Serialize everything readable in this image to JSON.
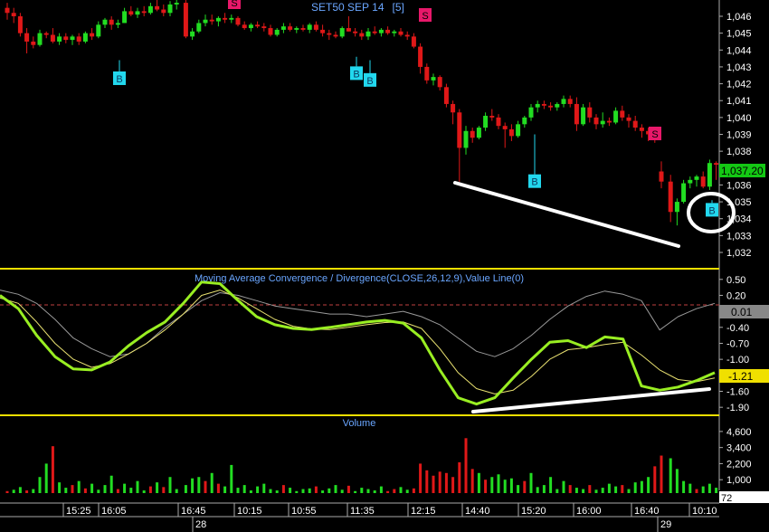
{
  "colors": {
    "background": "#000000",
    "up_candle": "#22dd22",
    "down_candle": "#e01818",
    "panel_border": "#f0e000",
    "title_text": "#6aa6ff",
    "axis_text": "#ffffff",
    "buy_marker": "#22d8ee",
    "sell_marker": "#e8186a",
    "macd_line": "#99ee22",
    "signal_line": "#e8e070",
    "value_line": "#999999",
    "zero_line": "#c04040",
    "price_tag_bg": "#14c814",
    "macd_tag_bg": "#f0e000",
    "volume_tag_bg": "#ffffff",
    "trendline": "#ffffff"
  },
  "price_panel": {
    "title": "SET50 SEP 14",
    "interval": "[5]",
    "last_price_tag": "1,037.20",
    "y_ticks": [
      "1,046",
      "1,045",
      "1,044",
      "1,043",
      "1,042",
      "1,041",
      "1,040",
      "1,039",
      "1,038",
      "1,037",
      "1,036",
      "1,035",
      "1,034",
      "1,033",
      "1,032"
    ]
  },
  "macd_panel": {
    "title": "Moving Average Convergence / Divergence(CLOSE,26,12,9),Value Line(0)",
    "y_ticks": [
      "0.50",
      "0.20",
      "-0.10",
      "-0.40",
      "-0.70",
      "-1.00",
      "-1.30",
      "-1.60",
      "-1.90"
    ],
    "value_tags": [
      "0.01",
      "-1.21"
    ]
  },
  "volume_panel": {
    "title": "Volume",
    "y_ticks": [
      "4,600",
      "3,400",
      "2,200",
      "1,000"
    ],
    "value_tag": "72"
  },
  "x_axis": {
    "time_labels": [
      "15:25",
      "16:05",
      "16:45",
      "10:15",
      "10:55",
      "11:35",
      "12:15",
      "14:40",
      "15:20",
      "16:00",
      "16:40",
      "10:10"
    ],
    "date_labels": [
      "28",
      "29"
    ]
  },
  "signal_label_buy": "B",
  "signal_label_sell": "S",
  "chart_data": {
    "type": "candlestick",
    "title": "SET50 SEP 14 [5]",
    "ylim": [
      1031.5,
      1047
    ],
    "candles": [
      [
        1046.5,
        1046.8,
        1045.8,
        1046.2
      ],
      [
        1046.2,
        1046.5,
        1045.6,
        1046.0
      ],
      [
        1046.0,
        1046.2,
        1044.8,
        1045.0
      ],
      [
        1045.0,
        1045.3,
        1043.8,
        1044.5
      ],
      [
        1044.5,
        1044.8,
        1044.1,
        1044.3
      ],
      [
        1044.3,
        1045.2,
        1044.2,
        1045.0
      ],
      [
        1045.0,
        1045.1,
        1044.7,
        1044.9
      ],
      [
        1044.9,
        1045.3,
        1044.4,
        1044.5
      ],
      [
        1044.5,
        1045.0,
        1044.3,
        1044.8
      ],
      [
        1044.8,
        1045.0,
        1044.4,
        1044.6
      ],
      [
        1044.6,
        1044.9,
        1044.3,
        1044.8
      ],
      [
        1044.8,
        1045.0,
        1044.3,
        1044.5
      ],
      [
        1044.5,
        1045.1,
        1044.4,
        1045.0
      ],
      [
        1045.0,
        1045.3,
        1044.6,
        1044.8
      ],
      [
        1044.8,
        1045.7,
        1044.7,
        1045.5
      ],
      [
        1045.5,
        1045.9,
        1045.3,
        1045.8
      ],
      [
        1045.8,
        1046.0,
        1045.2,
        1045.5
      ],
      [
        1045.5,
        1045.8,
        1045.3,
        1045.6
      ],
      [
        1045.6,
        1046.5,
        1045.6,
        1046.3
      ],
      [
        1046.3,
        1046.6,
        1046.0,
        1046.1
      ],
      [
        1046.1,
        1046.5,
        1045.9,
        1046.3
      ],
      [
        1046.3,
        1046.6,
        1046.0,
        1046.2
      ],
      [
        1046.2,
        1046.8,
        1046.1,
        1046.6
      ],
      [
        1046.6,
        1047.0,
        1046.3,
        1046.4
      ],
      [
        1046.4,
        1046.7,
        1046.0,
        1046.2
      ],
      [
        1046.2,
        1046.9,
        1046.0,
        1046.7
      ],
      [
        1046.7,
        1047.0,
        1046.4,
        1046.8
      ],
      [
        1046.8,
        1047.0,
        1044.7,
        1044.8
      ],
      [
        1044.8,
        1045.3,
        1044.6,
        1045.1
      ],
      [
        1045.1,
        1045.8,
        1045.0,
        1045.6
      ],
      [
        1045.6,
        1046.1,
        1045.4,
        1045.8
      ],
      [
        1045.8,
        1046.1,
        1045.5,
        1045.7
      ],
      [
        1045.7,
        1046.0,
        1045.4,
        1045.9
      ],
      [
        1045.9,
        1046.2,
        1045.6,
        1045.8
      ],
      [
        1045.8,
        1046.1,
        1045.6,
        1045.9
      ],
      [
        1045.9,
        1046.0,
        1045.4,
        1045.5
      ],
      [
        1045.5,
        1045.7,
        1045.2,
        1045.3
      ],
      [
        1045.3,
        1045.6,
        1045.1,
        1045.5
      ],
      [
        1045.5,
        1045.7,
        1045.3,
        1045.4
      ],
      [
        1045.4,
        1045.6,
        1045.1,
        1045.3
      ],
      [
        1045.3,
        1045.5,
        1044.8,
        1044.9
      ],
      [
        1044.9,
        1045.3,
        1044.8,
        1045.2
      ],
      [
        1045.2,
        1045.6,
        1045.0,
        1045.4
      ],
      [
        1045.4,
        1045.6,
        1045.1,
        1045.2
      ],
      [
        1045.2,
        1045.4,
        1045.0,
        1045.3
      ],
      [
        1045.3,
        1045.5,
        1045.1,
        1045.2
      ],
      [
        1045.2,
        1045.6,
        1045.0,
        1045.5
      ],
      [
        1045.5,
        1045.7,
        1045.1,
        1045.2
      ],
      [
        1045.2,
        1045.5,
        1044.8,
        1045.0
      ],
      [
        1045.0,
        1045.2,
        1044.6,
        1044.9
      ],
      [
        1044.9,
        1045.1,
        1044.7,
        1044.8
      ],
      [
        1044.8,
        1045.4,
        1044.7,
        1045.3
      ],
      [
        1045.3,
        1046.0,
        1045.1,
        1045.1
      ],
      [
        1045.1,
        1045.3,
        1044.8,
        1045.0
      ],
      [
        1045.0,
        1045.2,
        1044.6,
        1044.8
      ],
      [
        1044.8,
        1045.3,
        1044.6,
        1045.1
      ],
      [
        1045.1,
        1045.4,
        1044.9,
        1045.0
      ],
      [
        1045.0,
        1045.3,
        1044.8,
        1045.2
      ],
      [
        1045.2,
        1045.4,
        1044.9,
        1045.0
      ],
      [
        1045.0,
        1045.2,
        1044.8,
        1045.1
      ],
      [
        1045.1,
        1045.3,
        1044.8,
        1044.9
      ],
      [
        1044.9,
        1045.1,
        1044.6,
        1044.8
      ],
      [
        1044.8,
        1045.0,
        1044.1,
        1044.2
      ],
      [
        1044.2,
        1044.4,
        1042.6,
        1043.0
      ],
      [
        1043.0,
        1043.2,
        1042.0,
        1042.2
      ],
      [
        1042.2,
        1042.6,
        1041.9,
        1042.4
      ],
      [
        1042.4,
        1042.5,
        1041.6,
        1041.8
      ],
      [
        1041.8,
        1042.0,
        1040.6,
        1040.8
      ],
      [
        1040.8,
        1041.0,
        1039.6,
        1040.3
      ],
      [
        1040.3,
        1040.5,
        1036.2,
        1038.2
      ],
      [
        1038.2,
        1039.5,
        1037.8,
        1039.2
      ],
      [
        1039.2,
        1039.4,
        1038.5,
        1038.8
      ],
      [
        1038.8,
        1039.5,
        1038.7,
        1039.4
      ],
      [
        1039.4,
        1040.3,
        1039.2,
        1040.1
      ],
      [
        1040.1,
        1040.5,
        1039.8,
        1040.0
      ],
      [
        1040.0,
        1040.2,
        1039.3,
        1039.5
      ],
      [
        1039.5,
        1039.7,
        1038.2,
        1039.3
      ],
      [
        1039.3,
        1039.6,
        1038.6,
        1038.9
      ],
      [
        1038.9,
        1039.8,
        1038.8,
        1039.6
      ],
      [
        1039.6,
        1040.1,
        1039.4,
        1040.0
      ],
      [
        1040.0,
        1040.8,
        1039.8,
        1040.6
      ],
      [
        1040.6,
        1041.0,
        1040.3,
        1040.8
      ],
      [
        1040.8,
        1041.0,
        1040.5,
        1040.7
      ],
      [
        1040.7,
        1040.9,
        1040.4,
        1040.6
      ],
      [
        1040.6,
        1040.9,
        1040.4,
        1040.8
      ],
      [
        1040.8,
        1041.3,
        1040.6,
        1041.1
      ],
      [
        1041.1,
        1041.3,
        1040.6,
        1040.8
      ],
      [
        1040.8,
        1041.2,
        1039.2,
        1039.6
      ],
      [
        1039.6,
        1040.8,
        1039.5,
        1040.6
      ],
      [
        1040.6,
        1040.9,
        1039.7,
        1040.0
      ],
      [
        1040.0,
        1040.2,
        1039.3,
        1039.6
      ],
      [
        1039.6,
        1040.3,
        1039.4,
        1039.8
      ],
      [
        1039.8,
        1040.0,
        1039.5,
        1039.7
      ],
      [
        1039.7,
        1040.6,
        1039.6,
        1040.4
      ],
      [
        1040.4,
        1040.7,
        1039.8,
        1040.0
      ],
      [
        1040.0,
        1040.2,
        1039.4,
        1039.8
      ],
      [
        1039.8,
        1040.1,
        1039.2,
        1039.4
      ],
      [
        1039.4,
        1039.6,
        1038.8,
        1039.2
      ],
      [
        1039.2,
        1039.4,
        1038.6,
        1039.0
      ],
      [
        1039.0,
        1039.2,
        1038.5,
        1038.7
      ],
      [
        1036.8,
        1037.4,
        1035.8,
        1036.2
      ],
      [
        1036.2,
        1036.6,
        1033.8,
        1034.4
      ],
      [
        1034.4,
        1035.2,
        1033.6,
        1035.0
      ],
      [
        1035.0,
        1036.3,
        1034.9,
        1036.1
      ],
      [
        1036.1,
        1036.5,
        1035.8,
        1036.3
      ],
      [
        1036.3,
        1036.6,
        1035.9,
        1036.5
      ],
      [
        1036.5,
        1036.8,
        1035.8,
        1035.9
      ],
      [
        1035.9,
        1037.5,
        1035.7,
        1037.3
      ],
      [
        1037.3,
        1037.4,
        1036.3,
        1037.2
      ]
    ],
    "buy_signals": [
      [
        1043.5,
        1043.5
      ],
      [
        1043.5,
        1042.6
      ],
      [
        1042.6,
        1036.7
      ],
      [
        1036.7,
        1034.5
      ]
    ],
    "sell_signals": [
      1047.5,
      1046.2,
      1038.9
    ],
    "macd_ylim": [
      -2.0,
      0.65
    ],
    "macd_line": [
      0.2,
      -0.05,
      -0.55,
      -0.95,
      -1.18,
      -1.2,
      -1.05,
      -0.75,
      -0.5,
      -0.3,
      0.05,
      0.45,
      0.42,
      0.1,
      -0.2,
      -0.35,
      -0.42,
      -0.44,
      -0.4,
      -0.35,
      -0.3,
      -0.27,
      -0.32,
      -0.6,
      -1.2,
      -1.72,
      -1.84,
      -1.72,
      -1.35,
      -1.0,
      -0.68,
      -0.65,
      -0.78,
      -0.58,
      -0.62,
      -1.5,
      -1.58,
      -1.52,
      -1.4,
      -1.25
    ],
    "signal_line": [
      0.15,
      0.05,
      -0.3,
      -0.7,
      -1.0,
      -1.15,
      -1.08,
      -0.9,
      -0.7,
      -0.45,
      -0.15,
      0.2,
      0.3,
      0.15,
      -0.05,
      -0.25,
      -0.38,
      -0.43,
      -0.44,
      -0.4,
      -0.35,
      -0.31,
      -0.3,
      -0.42,
      -0.8,
      -1.25,
      -1.55,
      -1.65,
      -1.58,
      -1.32,
      -1.0,
      -0.82,
      -0.78,
      -0.72,
      -0.68,
      -0.92,
      -1.2,
      -1.38,
      -1.42,
      -1.35
    ],
    "value_line": [
      0.3,
      0.22,
      0.05,
      -0.25,
      -0.6,
      -0.8,
      -0.95,
      -0.9,
      -0.7,
      -0.4,
      -0.15,
      0.1,
      0.25,
      0.2,
      0.1,
      0.0,
      -0.05,
      -0.1,
      -0.15,
      -0.15,
      -0.2,
      -0.15,
      -0.1,
      -0.2,
      -0.35,
      -0.6,
      -0.85,
      -0.95,
      -0.8,
      -0.55,
      -0.25,
      0.0,
      0.18,
      0.28,
      0.22,
      0.1,
      -0.45,
      -0.2,
      -0.05,
      0.05
    ],
    "volume_ylim": [
      0,
      5200
    ],
    "volume": [
      [
        150,
        0
      ],
      [
        250,
        1
      ],
      [
        450,
        1
      ],
      [
        200,
        0
      ],
      [
        300,
        1
      ],
      [
        1200,
        1
      ],
      [
        2200,
        1
      ],
      [
        3500,
        0
      ],
      [
        800,
        1
      ],
      [
        400,
        1
      ],
      [
        600,
        0
      ],
      [
        900,
        1
      ],
      [
        350,
        0
      ],
      [
        700,
        1
      ],
      [
        250,
        1
      ],
      [
        600,
        1
      ],
      [
        1300,
        1
      ],
      [
        300,
        0
      ],
      [
        700,
        1
      ],
      [
        400,
        1
      ],
      [
        900,
        1
      ],
      [
        200,
        1
      ],
      [
        500,
        0
      ],
      [
        800,
        1
      ],
      [
        450,
        0
      ],
      [
        1200,
        1
      ],
      [
        300,
        1
      ],
      [
        600,
        1
      ],
      [
        1100,
        1
      ],
      [
        1200,
        1
      ],
      [
        900,
        0
      ],
      [
        1500,
        1
      ],
      [
        700,
        0
      ],
      [
        500,
        1
      ],
      [
        2100,
        1
      ],
      [
        400,
        1
      ],
      [
        600,
        1
      ],
      [
        200,
        1
      ],
      [
        500,
        1
      ],
      [
        700,
        1
      ],
      [
        300,
        1
      ],
      [
        200,
        1
      ],
      [
        600,
        0
      ],
      [
        400,
        1
      ],
      [
        150,
        1
      ],
      [
        300,
        1
      ],
      [
        350,
        1
      ],
      [
        500,
        0
      ],
      [
        200,
        1
      ],
      [
        350,
        1
      ],
      [
        600,
        1
      ],
      [
        250,
        1
      ],
      [
        550,
        0
      ],
      [
        150,
        1
      ],
      [
        400,
        1
      ],
      [
        300,
        1
      ],
      [
        200,
        1
      ],
      [
        500,
        1
      ],
      [
        150,
        0
      ],
      [
        300,
        0
      ],
      [
        450,
        1
      ],
      [
        250,
        1
      ],
      [
        350,
        0
      ],
      [
        2200,
        0
      ],
      [
        1700,
        0
      ],
      [
        1300,
        0
      ],
      [
        1600,
        0
      ],
      [
        1500,
        0
      ],
      [
        1200,
        0
      ],
      [
        2300,
        0
      ],
      [
        4100,
        0
      ],
      [
        1800,
        0
      ],
      [
        1500,
        1
      ],
      [
        1000,
        0
      ],
      [
        1200,
        1
      ],
      [
        1400,
        1
      ],
      [
        1000,
        1
      ],
      [
        1100,
        1
      ],
      [
        600,
        1
      ],
      [
        900,
        0
      ],
      [
        1500,
        1
      ],
      [
        450,
        1
      ],
      [
        600,
        1
      ],
      [
        1200,
        1
      ],
      [
        300,
        1
      ],
      [
        900,
        1
      ],
      [
        600,
        0
      ],
      [
        400,
        1
      ],
      [
        300,
        1
      ],
      [
        600,
        0
      ],
      [
        250,
        1
      ],
      [
        400,
        1
      ],
      [
        700,
        1
      ],
      [
        500,
        1
      ],
      [
        600,
        0
      ],
      [
        300,
        1
      ],
      [
        800,
        1
      ],
      [
        900,
        1
      ],
      [
        1200,
        1
      ],
      [
        2000,
        0
      ],
      [
        2800,
        0
      ],
      [
        2600,
        1
      ],
      [
        1800,
        1
      ],
      [
        900,
        1
      ],
      [
        700,
        1
      ],
      [
        300,
        0
      ],
      [
        500,
        1
      ],
      [
        700,
        1
      ],
      [
        400,
        1
      ]
    ]
  }
}
